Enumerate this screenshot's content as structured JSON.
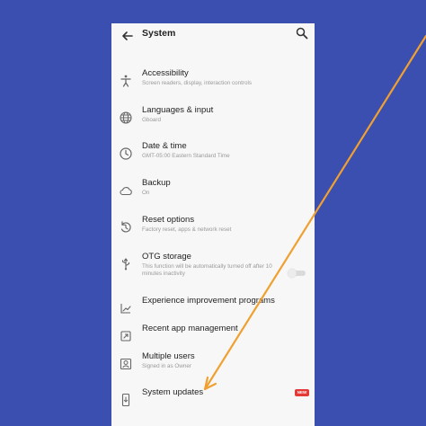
{
  "header": {
    "title": "System",
    "back_icon": "back-arrow-icon",
    "search_icon": "search-icon"
  },
  "items": [
    {
      "label": "Accessibility",
      "sub": "Screen readers, display, interaction controls",
      "icon": "accessibility-icon"
    },
    {
      "label": "Languages & input",
      "sub": "Gboard",
      "icon": "globe-icon"
    },
    {
      "label": "Date & time",
      "sub": "GMT-05:00 Eastern Standard Time",
      "icon": "clock-icon"
    },
    {
      "label": "Backup",
      "sub": "On",
      "icon": "cloud-icon"
    },
    {
      "label": "Reset options",
      "sub": "Factory reset, apps & network reset",
      "icon": "reset-icon"
    },
    {
      "label": "OTG storage",
      "sub": "This function will be automatically turned off after 10 minutes inactivity",
      "icon": "usb-icon"
    },
    {
      "label": "Experience improvement programs",
      "sub": "",
      "icon": "chart-icon"
    },
    {
      "label": "Recent app management",
      "sub": "",
      "icon": "apps-icon"
    },
    {
      "label": "Multiple users",
      "sub": "Signed in as Owner",
      "icon": "user-icon"
    },
    {
      "label": "System updates",
      "sub": "",
      "icon": "phone-update-icon",
      "badge": "NEW"
    }
  ],
  "otg_toggle": {
    "state": "off"
  },
  "colors": {
    "background": "#3b4fb0",
    "arrow": "#f0a030",
    "badge": "#e53935"
  }
}
